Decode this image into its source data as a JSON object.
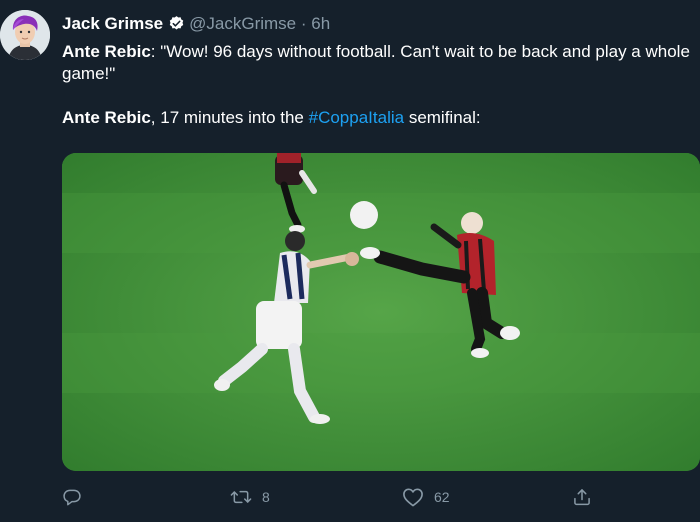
{
  "tweet": {
    "author_name": "Jack Grimse",
    "handle": "@JackGrimse",
    "separator": "·",
    "time_ago": "6h",
    "line1_bold": "Ante Rebic",
    "line1_rest": ": \"Wow! 96 days without football. Can't wait to be back and play a whole game!\"",
    "line2_bold": "Ante Rebic",
    "line2_mid": ", 17 minutes into the ",
    "hashtag": "#CoppaItalia",
    "line2_end": " semifinal:"
  },
  "actions": {
    "reply_count": "",
    "retweet_count": "8",
    "like_count": "62"
  },
  "icons": [
    "verified-badge-icon",
    "reply-icon",
    "retweet-icon",
    "like-icon",
    "share-icon"
  ],
  "colors": {
    "background": "#15202b",
    "text": "#ffffff",
    "secondary_text": "#8899a6",
    "hashtag": "#1da1f2",
    "verified": "#ffffff",
    "pitch": "#3d8a36"
  }
}
